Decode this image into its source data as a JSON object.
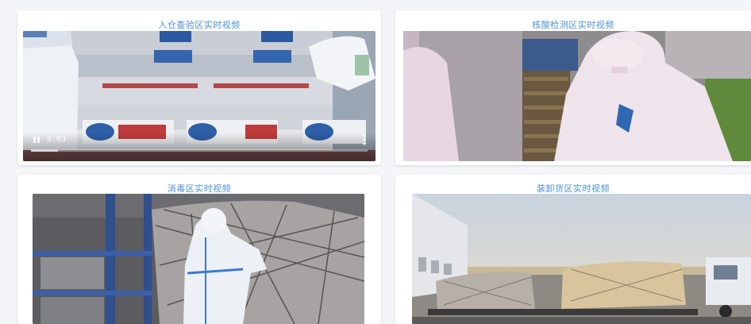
{
  "cards": [
    {
      "title": "入仓查验区实时视频",
      "time": "0:03",
      "progress": 0.08
    },
    {
      "title": "核酸检测区实时视频"
    },
    {
      "title": "消毒区实时视频"
    },
    {
      "title": "装卸货区实时视频"
    }
  ]
}
